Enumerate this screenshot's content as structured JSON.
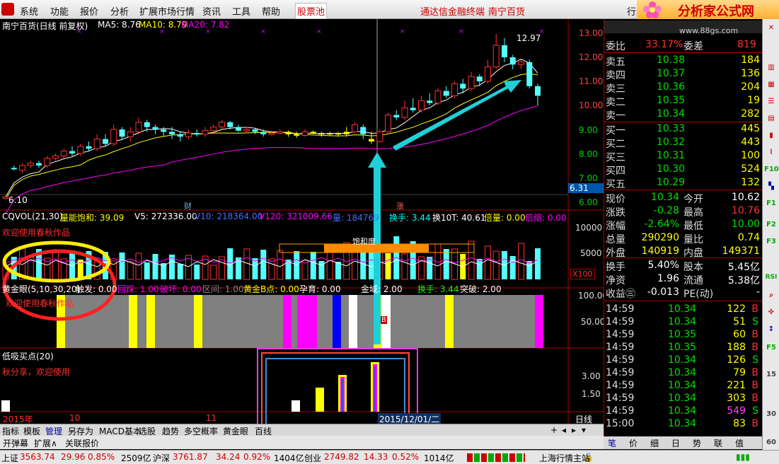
{
  "menu": {
    "items": [
      "系统",
      "功能",
      "报价",
      "分析",
      "扩展市场行情",
      "资讯",
      "工具",
      "帮助"
    ],
    "special": "股票池",
    "broker": "通达信金融终端",
    "stock": "南宁百货",
    "cut": "行",
    "logo_text": "分析家公式网",
    "logo_url": "www.88gs.com"
  },
  "main_chart": {
    "title": "南宁百货(日线 前复权)",
    "ma5": "MA5: 8.76",
    "ma10": "MA10: 8.79",
    "ma20": "MA20: 7.82",
    "high_label": "12.97",
    "low_label": "6.10",
    "price_axis": [
      "13.00",
      "12.00",
      "11.00",
      "10.00",
      "9.00",
      "8.00",
      "7.00",
      "6.00"
    ],
    "current_price_tag": "6.31",
    "marker_cai": "财",
    "marker_zhang": "涨",
    "colors": {
      "up": "#ff3030",
      "down": "#54ffff",
      "ma5": "#ffffff",
      "ma10": "#ffff00",
      "ma20": "#ff00ff",
      "arrow": "#1fd0d8"
    }
  },
  "volume_panel": {
    "cqvol": "CQVOL(21,30)",
    "saturation": "量能饱和: 39.09",
    "v5": "V5: 272336.00",
    "v10": "V10: 218364.00",
    "v120": "V120: 321009.66",
    "vol": "量: 184769",
    "turnover": "换手: 3.44",
    "turnover10": "换10T: 40.61",
    "double_vol": "倍量: 0.00",
    "shrink": "倍缩: 0.00",
    "welcome": "欢迎使用春秋作品",
    "sat_box": "饱和度",
    "axis": [
      "10000",
      "5000"
    ],
    "x100": "X100"
  },
  "gold_panel": {
    "name": "黄金眼(5,10,30,20)",
    "trigger": "触发: 0.00",
    "back": "回踩: 1.00",
    "break": "破坏: 0.00",
    "zone": "区间: 1.00",
    "gold_b": "黄金B点: 0.00",
    "pregnant": "孕育: 0.00",
    "golden": "金域: 2.00",
    "turnover": "换手: 3.44",
    "breakout": "突破: 2.00",
    "welcome": "欢迎使用春秋作品",
    "axis": [
      "100.00",
      "50.00"
    ],
    "b_mark": "B"
  },
  "low_panel": {
    "name": "低吸买点(20)",
    "share": "秋分享，欢迎使用",
    "axis": [
      "3.00",
      "1.50"
    ]
  },
  "time_axis": {
    "year": "2015年",
    "m10": "10",
    "m11": "11",
    "date_tag": "2015/12/01/二",
    "period": "日线"
  },
  "bottom_tabs": [
    "指标",
    "模板",
    "管理",
    "另存为",
    "MACD基本",
    "选股",
    "趋势",
    "多空概率",
    "黄金眼",
    "百线"
  ],
  "bottom_tabs2": [
    "开弹幕",
    "扩展∧",
    "关联报价"
  ],
  "right_tabs": [
    "笔",
    "价",
    "细",
    "日",
    "势",
    "联",
    "值"
  ],
  "quote": {
    "weibi_label": "委比",
    "weibi": "33.17%",
    "weicha_label": "委差",
    "weicha": "819",
    "sell": [
      {
        "label": "卖五",
        "price": "10.38",
        "vol": "184"
      },
      {
        "label": "卖四",
        "price": "10.37",
        "vol": "136"
      },
      {
        "label": "卖三",
        "price": "10.36",
        "vol": "204"
      },
      {
        "label": "卖二",
        "price": "10.35",
        "vol": "19"
      },
      {
        "label": "卖一",
        "price": "10.34",
        "vol": "282"
      }
    ],
    "buy": [
      {
        "label": "买一",
        "price": "10.33",
        "vol": "445"
      },
      {
        "label": "买二",
        "price": "10.32",
        "vol": "443"
      },
      {
        "label": "买三",
        "price": "10.31",
        "vol": "100"
      },
      {
        "label": "买四",
        "price": "10.30",
        "vol": "524"
      },
      {
        "label": "买五",
        "price": "10.29",
        "vol": "132"
      }
    ],
    "stats": [
      {
        "l1": "现价",
        "v1": "10.34",
        "c1": "#00e000",
        "l2": "今开",
        "v2": "10.62",
        "c2": "#ffffff"
      },
      {
        "l1": "涨跌",
        "v1": "-0.28",
        "c1": "#00e000",
        "l2": "最高",
        "v2": "10.76",
        "c2": "#ff3030"
      },
      {
        "l1": "涨幅",
        "v1": "-2.64%",
        "c1": "#00e000",
        "l2": "最低",
        "v2": "10.00",
        "c2": "#00e000"
      },
      {
        "l1": "总量",
        "v1": "290290",
        "c1": "#ffff00",
        "l2": "量比",
        "v2": "0.74",
        "c2": "#ffff00"
      },
      {
        "l1": "外盘",
        "v1": "140919",
        "c1": "#ffff00",
        "l2": "内盘",
        "v2": "149371",
        "c2": "#ffff00"
      }
    ],
    "stats2": [
      {
        "l1": "换手",
        "v1": "5.40%",
        "l2": "股本",
        "v2": "5.45亿"
      },
      {
        "l1": "净资",
        "v1": "1.96",
        "l2": "流通",
        "v2": "5.38亿"
      },
      {
        "l1": "收益㊂",
        "v1": "-0.013",
        "l2": "PE(动)",
        "v2": "-"
      }
    ],
    "ticks": [
      {
        "t": "14:59",
        "p": "10.34",
        "v": "122",
        "s": "B"
      },
      {
        "t": "14:59",
        "p": "10.34",
        "v": "51",
        "s": "S"
      },
      {
        "t": "14:59",
        "p": "10.35",
        "v": "60",
        "s": "B"
      },
      {
        "t": "14:59",
        "p": "10.35",
        "v": "188",
        "s": "B"
      },
      {
        "t": "14:59",
        "p": "10.34",
        "v": "126",
        "s": "S"
      },
      {
        "t": "14:59",
        "p": "10.34",
        "v": "79",
        "s": "B"
      },
      {
        "t": "14:59",
        "p": "10.34",
        "v": "221",
        "s": "B"
      },
      {
        "t": "14:59",
        "p": "10.34",
        "v": "303",
        "s": "B"
      },
      {
        "t": "14:59",
        "p": "10.34",
        "v": "549",
        "s": "S"
      },
      {
        "t": "15:00",
        "p": "10.34",
        "v": "83",
        "s": "B"
      }
    ]
  },
  "sidebar_tools": [
    "F10",
    "RSI",
    "F1",
    "F2",
    "F3",
    "F5",
    "15",
    "30",
    "60"
  ],
  "status": {
    "sh_label": "上证",
    "sh": "3563.74",
    "sh_chg": "29.96",
    "sh_pct": "0.85%",
    "sh_amt": "2509亿",
    "sz_label": "沪深",
    "sz": "3761.87",
    "sz_chg": "34.24",
    "sz_pct": "0.92%",
    "sz_amt": "1404亿",
    "cy_label": "创业",
    "cy": "2749.82",
    "cy_chg": "14.33",
    "cy_pct": "0.52%",
    "cy_amt": "1014亿",
    "server": "上海行情主站"
  }
}
